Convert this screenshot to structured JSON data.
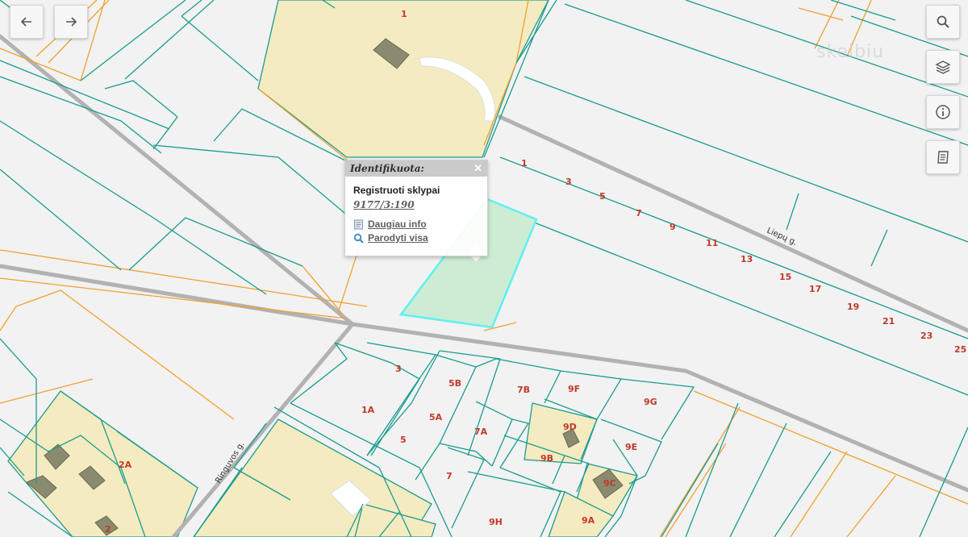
{
  "nav": {
    "back_icon": "arrow-left-icon",
    "forward_icon": "arrow-right-icon"
  },
  "toolbar": {
    "search_icon": "search-icon",
    "layers_icon": "layers-icon",
    "info_icon": "info-icon",
    "legend_icon": "document-icon"
  },
  "watermark": "skelbiu",
  "popup": {
    "title": "Identifikuota:",
    "layer_name": "Registruoti sklypai",
    "parcel_id": "9177/3:190",
    "more_info": "Daugiau info",
    "show_all": "Parodyti visa"
  },
  "streets": {
    "liepu": "Liepų g.",
    "ringuvos": "Ringuvos g."
  },
  "colors": {
    "parcel_border": "#1a9c8f",
    "orange_line": "#f0a030",
    "road": "#b0b0b0",
    "building_area": "#f5ebc0",
    "selected_fill": "#cdecd4",
    "selected_border": "#5ff0f0",
    "label": "#c0392b"
  },
  "parcel_labels": [
    "1",
    "1",
    "3",
    "5",
    "7",
    "9",
    "11",
    "13",
    "15",
    "17",
    "19",
    "21",
    "23",
    "25",
    "3",
    "5B",
    "7B",
    "9F",
    "9G",
    "1A",
    "5A",
    "7A",
    "9D",
    "5",
    "9E",
    "9B",
    "7",
    "9C",
    "9H",
    "9A",
    "2A",
    "2"
  ]
}
